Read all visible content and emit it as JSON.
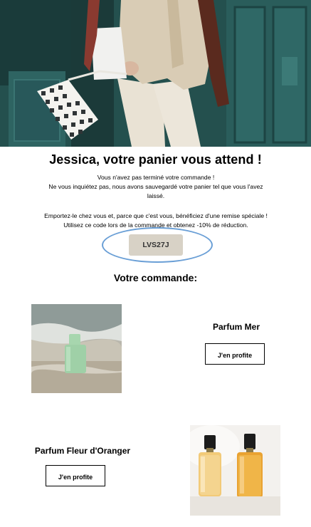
{
  "hero": {
    "image": "fashion-woman-walking-with-checkered-bag"
  },
  "title": "Jessica, votre panier vous attend !",
  "paragraph1": [
    "Vous n'avez pas terminé votre commande !",
    "Ne vous inquiétez pas, nous avons sauvegardé votre panier tel que vous l'avez",
    "laissé."
  ],
  "paragraph2": [
    "Emportez-le chez vous et, parce que c'est vous, bénéficiez d'une remise spéciale !",
    "Utilisez ce code lors de la commande et obtenez -10% de réduction."
  ],
  "promo_code": "LVS27J",
  "colors": {
    "code_bg": "#d8d2c6",
    "highlight_ellipse": "#6a9fd6"
  },
  "order_title": "Votre commande:",
  "products": [
    {
      "name": "Parfum Mer",
      "cta": "J'en profite",
      "image": "green-perfume-bottle-on-beach"
    },
    {
      "name": "Parfum Fleur d'Oranger",
      "cta": "J'en profite",
      "image": "two-amber-perfume-bottles"
    }
  ]
}
